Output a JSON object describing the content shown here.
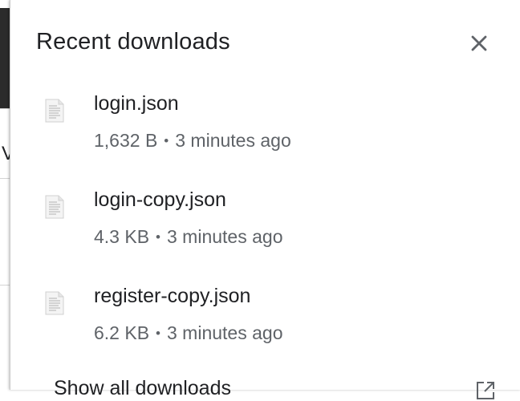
{
  "panel": {
    "title": "Recent downloads",
    "close_icon": "close-icon"
  },
  "downloads": [
    {
      "name": "login.json",
      "size": "1,632 B",
      "separator": "•",
      "time": "3 minutes ago",
      "icon": "file-icon"
    },
    {
      "name": "login-copy.json",
      "size": "4.3 KB",
      "separator": "•",
      "time": "3 minutes ago",
      "icon": "file-icon"
    },
    {
      "name": "register-copy.json",
      "size": "6.2 KB",
      "separator": "•",
      "time": "3 minutes ago",
      "icon": "file-icon"
    }
  ],
  "footer": {
    "show_all_label": "Show all downloads",
    "open_icon": "open-in-new-icon"
  }
}
